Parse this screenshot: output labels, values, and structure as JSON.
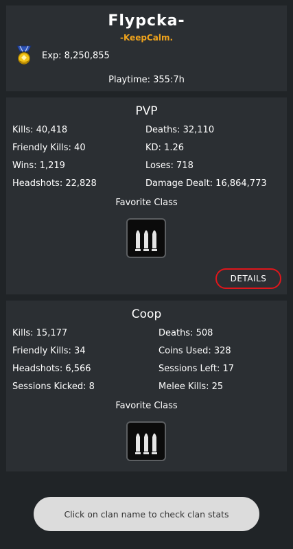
{
  "profile": {
    "player_name": "Flypcka-",
    "clan_name": "-KeepCalm.",
    "exp_label": "Exp: 8,250,855",
    "playtime_label": "Playtime: 355:7h",
    "rank_icon": "rank-medal-icon"
  },
  "pvp": {
    "title": "PVP",
    "stats": [
      {
        "left": "Kills: 40,418",
        "right": "Deaths: 32,110"
      },
      {
        "left": "Friendly Kills: 40",
        "right": "KD: 1.26"
      },
      {
        "left": "Wins: 1,219",
        "right": "Loses: 718"
      },
      {
        "left": "Headshots: 22,828",
        "right": "Damage Dealt: 16,864,773"
      }
    ],
    "favorite_class_label": "Favorite Class",
    "favorite_class_icon": "ammo-bullets-icon",
    "details_button": "DETAILS"
  },
  "coop": {
    "title": "Coop",
    "stats": [
      {
        "left": "Kills: 15,177",
        "right": "Deaths: 508"
      },
      {
        "left": "Friendly Kills: 34",
        "right": "Coins Used: 328"
      },
      {
        "left": "Headshots: 6,566",
        "right": "Sessions Left: 17"
      },
      {
        "left": "Sessions Kicked: 8",
        "right": "Melee Kills: 25"
      }
    ],
    "favorite_class_label": "Favorite Class",
    "favorite_class_icon": "ammo-bullets-icon"
  },
  "toast": {
    "message": "Click on clan name to check clan stats"
  },
  "colors": {
    "background": "#202427",
    "card": "#2b2f33",
    "clan_accent": "#f0a41c",
    "details_border": "#e0161b",
    "toast_bg": "#dcdcdc"
  }
}
